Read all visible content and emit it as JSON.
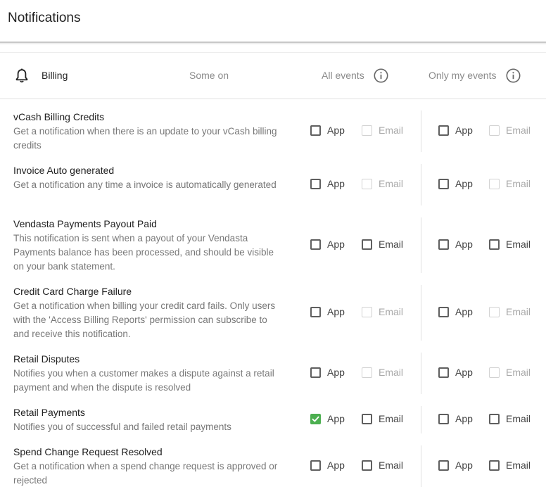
{
  "page": {
    "title": "Notifications"
  },
  "group": {
    "name": "Billing",
    "status": "Some on",
    "all_events_label": "All events",
    "my_events_label": "Only my events"
  },
  "labels": {
    "app": "App",
    "email": "Email"
  },
  "colors": {
    "checked": "#4caf50",
    "text_muted": "#777777",
    "divider": "#e0e0e0"
  },
  "rows": [
    {
      "name": "vCash Billing Credits",
      "desc": "Get a notification when there is an update to your vCash billing credits",
      "all": {
        "app": false,
        "email": false,
        "email_disabled": true
      },
      "mine": {
        "app": false,
        "email": false,
        "email_disabled": true
      }
    },
    {
      "name": "Invoice Auto generated",
      "desc": "Get a notification any time a invoice is automatically generated",
      "all": {
        "app": false,
        "email": false,
        "email_disabled": true
      },
      "mine": {
        "app": false,
        "email": false,
        "email_disabled": true
      }
    },
    {
      "name": "Vendasta Payments Payout Paid",
      "desc": "This notification is sent when a payout of your Vendasta Payments balance has been processed, and should be visible on your bank statement.",
      "all": {
        "app": false,
        "email": false,
        "email_disabled": false
      },
      "mine": {
        "app": false,
        "email": false,
        "email_disabled": false
      }
    },
    {
      "name": "Credit Card Charge Failure",
      "desc": "Get a notification when billing your credit card fails. Only users with the 'Access Billing Reports' permission can subscribe to and receive this notification.",
      "all": {
        "app": false,
        "email": false,
        "email_disabled": true
      },
      "mine": {
        "app": false,
        "email": false,
        "email_disabled": true
      }
    },
    {
      "name": "Retail Disputes",
      "desc": "Notifies you when a customer makes a dispute against a retail payment and when the dispute is resolved",
      "all": {
        "app": false,
        "email": false,
        "email_disabled": true
      },
      "mine": {
        "app": false,
        "email": false,
        "email_disabled": true
      }
    },
    {
      "name": "Retail Payments",
      "desc": "Notifies you of successful and failed retail payments",
      "all": {
        "app": true,
        "email": false,
        "email_disabled": false
      },
      "mine": {
        "app": false,
        "email": false,
        "email_disabled": false
      }
    },
    {
      "name": "Spend Change Request Resolved",
      "desc": "Get a notification when a spend change request is approved or rejected",
      "all": {
        "app": false,
        "email": false,
        "email_disabled": false
      },
      "mine": {
        "app": false,
        "email": false,
        "email_disabled": false
      }
    }
  ]
}
